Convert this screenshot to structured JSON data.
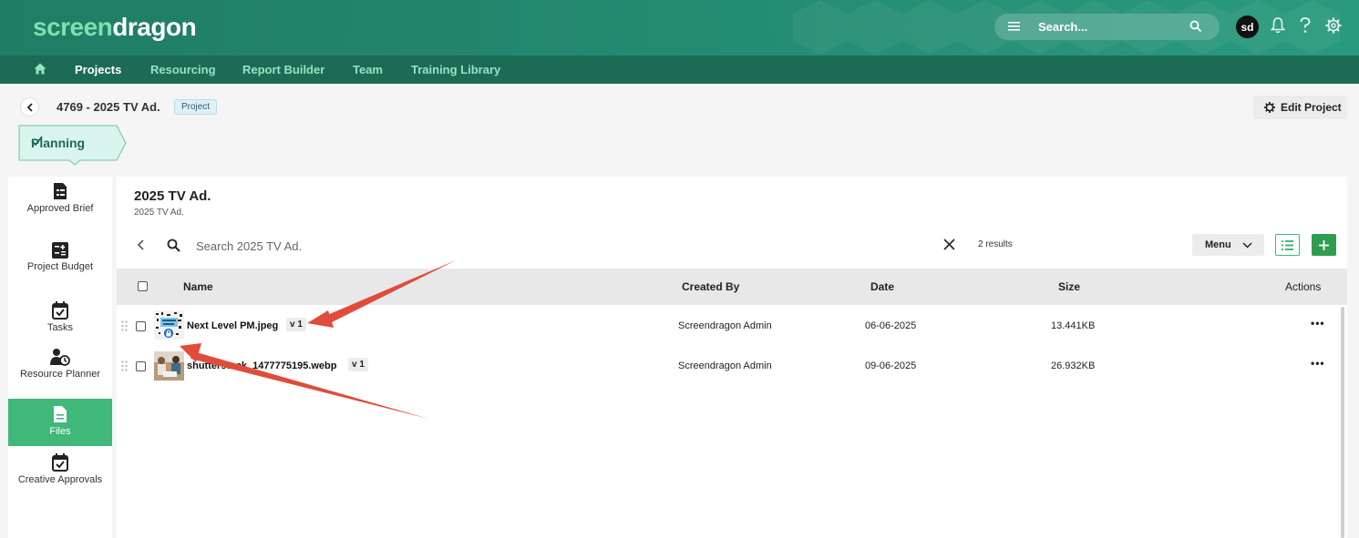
{
  "brand": {
    "part1": "screen",
    "part2": "dragon"
  },
  "header": {
    "search_placeholder": "Search...",
    "avatar_initials": "sd"
  },
  "nav": {
    "items": [
      "Projects",
      "Resourcing",
      "Report Builder",
      "Team",
      "Training Library"
    ],
    "active": "Projects"
  },
  "project": {
    "title": "4769 - 2025 TV Ad.",
    "badge": "Project",
    "edit_label": "Edit Project",
    "stage": "Planning"
  },
  "sidebar": {
    "items": [
      {
        "label": "Approved Brief",
        "icon": "brief-icon"
      },
      {
        "label": "Project Budget",
        "icon": "calculator-icon"
      },
      {
        "label": "Tasks",
        "icon": "calendar-check-icon"
      },
      {
        "label": "Resource Planner",
        "icon": "user-clock-icon"
      },
      {
        "label": "Files",
        "icon": "file-icon",
        "active": true
      },
      {
        "label": "Creative Approvals",
        "icon": "calendar-check-icon"
      }
    ]
  },
  "panel": {
    "title": "2025 TV Ad.",
    "subtitle": "2025 TV Ad.",
    "search_placeholder": "Search 2025 TV Ad.",
    "results": "2 results",
    "menu_label": "Menu"
  },
  "table": {
    "columns": [
      "Name",
      "Created By",
      "Date",
      "Size",
      "Actions"
    ],
    "rows": [
      {
        "name": "Next Level PM.jpeg",
        "version": "v 1",
        "created_by": "Screendragon Admin",
        "date": "06-06-2025",
        "size": "13.441KB",
        "locked": true
      },
      {
        "name": "shutterstock_1477775195.webp",
        "version": "v 1",
        "created_by": "Screendragon Admin",
        "date": "09-06-2025",
        "size": "26.932KB",
        "locked": false
      }
    ]
  },
  "colors": {
    "header": "#248c72",
    "nav": "#1c6b55",
    "accent": "#3fb87a",
    "arrow": "#e14b3b"
  }
}
